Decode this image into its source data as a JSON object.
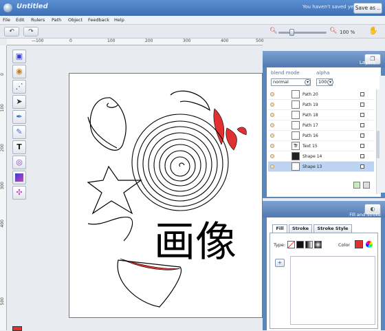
{
  "window": {
    "title": "Untitled",
    "save_status": "You haven't saved yet",
    "save_as_label": "Save as .."
  },
  "menu": [
    "File",
    "Edit",
    "Rulers",
    "Path",
    "Object",
    "Feedback",
    "Help"
  ],
  "toolbar": {
    "undo_icon": "undo-icon",
    "redo_icon": "redo-icon",
    "zoom_level": "100 %"
  },
  "ruler": {
    "top_labels": [
      "—100",
      "0",
      "100",
      "200",
      "300",
      "400",
      "500"
    ],
    "left_labels": [
      "0",
      "100",
      "200",
      "300",
      "400",
      "500"
    ]
  },
  "tools": [
    "select-tool",
    "zoom-tool",
    "node-tool",
    "arrow-tool",
    "pen-tool",
    "pencil-tool",
    "text-tool",
    "spiral-tool",
    "gradient-tool",
    "transform-tool"
  ],
  "canvas": {
    "text": "画像"
  },
  "layers": {
    "title": "Layers",
    "blend_mode_label": "blend mode",
    "blend_mode_value": "normal",
    "alpha_label": "alpha",
    "alpha_value": "100",
    "items": [
      {
        "name": "Path 20",
        "thumb": ""
      },
      {
        "name": "Path 19",
        "thumb": ""
      },
      {
        "name": "Path 18",
        "thumb": ""
      },
      {
        "name": "Path 17",
        "thumb": ""
      },
      {
        "name": "Path 16",
        "thumb": ""
      },
      {
        "name": "Text 15",
        "thumb": "Tr"
      },
      {
        "name": "Shape 14",
        "thumb": ""
      },
      {
        "name": "Shape 13",
        "thumb": ""
      }
    ],
    "selected_index": 7
  },
  "fill_stroke": {
    "title": "Fill and Stroke",
    "tabs": [
      "Fill",
      "Stroke",
      "Stroke Style"
    ],
    "active_tab": "Fill",
    "type_label": "Type:",
    "color_label": "Color",
    "color_value": "#e03030",
    "add_label": "+"
  },
  "colors": {
    "accent": "#e03030",
    "panel_blue": "#5b85bd",
    "selected_row": "#bcd4f2"
  }
}
